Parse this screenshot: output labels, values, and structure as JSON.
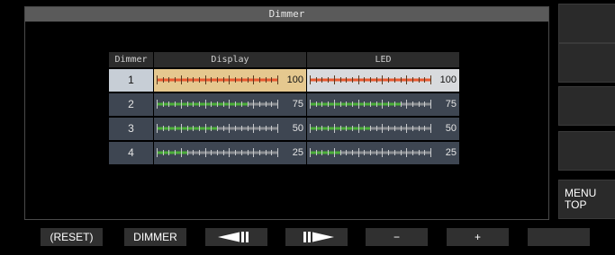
{
  "window": {
    "title": "Dimmer"
  },
  "table": {
    "headers": {
      "dimmer": "Dimmer",
      "display": "Display",
      "led": "LED"
    },
    "rows": [
      {
        "dimmer": "1",
        "display": "100",
        "led": "100",
        "selected": true
      },
      {
        "dimmer": "2",
        "display": "75",
        "led": "75",
        "selected": false
      },
      {
        "dimmer": "3",
        "display": "50",
        "led": "50",
        "selected": false
      },
      {
        "dimmer": "4",
        "display": "25",
        "led": "25",
        "selected": false
      }
    ]
  },
  "side_menu": {
    "menu_top": "MENU TOP"
  },
  "soft_keys": {
    "reset": "(RESET)",
    "dimmer": "DIMMER",
    "minus": "−",
    "plus": "+"
  },
  "colors": {
    "bar_fill": "#4caf3a",
    "bar_fill_selected": "#e8582f",
    "bar_empty": "#8a8d91",
    "selected_display_bg": "#e5c88f",
    "selected_led_bg": "#d8dadd",
    "cell_bg": "#3e4652"
  }
}
